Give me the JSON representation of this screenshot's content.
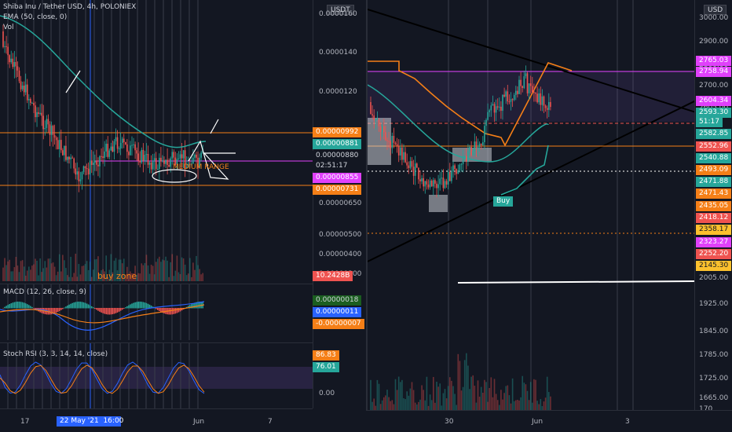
{
  "left": {
    "title": "Shiba Inu / Tether USD, 4h, POLONIEX",
    "ema_label": "EMA (50, close, 0)",
    "vol_label": "Vol",
    "currency": "USDT",
    "price_ticks": [
      "0.0000160",
      "0.0000140",
      "0.0000120",
      "0.0000100",
      "0.00000880",
      "0.00000650",
      "0.00000500",
      "0.00000400",
      "0.00000300",
      "00"
    ],
    "tags": [
      {
        "text": "0.00000992",
        "color": "#f57f17"
      },
      {
        "text": "0.00000881",
        "color": "#26a69a"
      },
      {
        "text": "0.00000880",
        "color": "#131722",
        "fg": "#d1d4dc"
      },
      {
        "text": "02:51:17",
        "color": "#131722",
        "fg": "#d1d4dc"
      },
      {
        "text": "0.00000855",
        "color": "#e040fb"
      },
      {
        "text": "0.00000731",
        "color": "#f57f17"
      },
      {
        "text": "10.2428B",
        "color": "#ef5350"
      }
    ],
    "annotations": {
      "range": "MEDIUM RANGE",
      "buy": "buy zone"
    },
    "macd": {
      "label": "MACD (12, 26, close, 9)",
      "tags": [
        {
          "text": "0.00000018",
          "color": "#1b5e20",
          "fg": "#d1d4dc"
        },
        {
          "text": "0.00000011",
          "color": "#2962ff"
        },
        {
          "text": "-0.00000007",
          "color": "#f57f17"
        }
      ]
    },
    "rsi": {
      "label": "Stoch RSI (3, 3, 14, 14, close)",
      "tags": [
        {
          "text": "86.83",
          "color": "#f57f17"
        },
        {
          "text": "76.01",
          "color": "#26a69a"
        }
      ],
      "tick": "0.00"
    },
    "time_ticks": [
      "17",
      "22 May '21",
      "16:00",
      "Jun",
      "7"
    ]
  },
  "right": {
    "currency": "USD",
    "price_ticks": [
      "3000.00",
      "2900.00",
      "2800.00",
      "2700.00",
      "2605.00",
      "2005.00",
      "1925.00",
      "1845.00",
      "1785.00",
      "1725.00",
      "1665.00",
      "170"
    ],
    "tags": [
      {
        "text": "2765.03",
        "color": "#e040fb"
      },
      {
        "text": "2758.94",
        "color": "#e040fb"
      },
      {
        "text": "2604.34",
        "color": "#e040fb"
      },
      {
        "text": "2593.30",
        "color": "#26a69a"
      },
      {
        "text": "51:17",
        "color": "#26a69a"
      },
      {
        "text": "2582.85",
        "color": "#26a69a"
      },
      {
        "text": "2552.96",
        "color": "#ef5350"
      },
      {
        "text": "2540.88",
        "color": "#26a69a"
      },
      {
        "text": "2493.09",
        "color": "#f57f17"
      },
      {
        "text": "2471.88",
        "color": "#26a69a"
      },
      {
        "text": "2471.43",
        "color": "#f57f17"
      },
      {
        "text": "2435.05",
        "color": "#f57f17"
      },
      {
        "text": "2418.12",
        "color": "#ef5350"
      },
      {
        "text": "2358.17",
        "color": "#fbc02d",
        "fg": "#131722"
      },
      {
        "text": "2323.27",
        "color": "#e040fb"
      },
      {
        "text": "2252.20",
        "color": "#ef5350"
      },
      {
        "text": "2145.30",
        "color": "#fbc02d",
        "fg": "#131722"
      }
    ],
    "buy_label": "Buy",
    "time_ticks": [
      "30",
      "Jun",
      "3"
    ]
  }
}
